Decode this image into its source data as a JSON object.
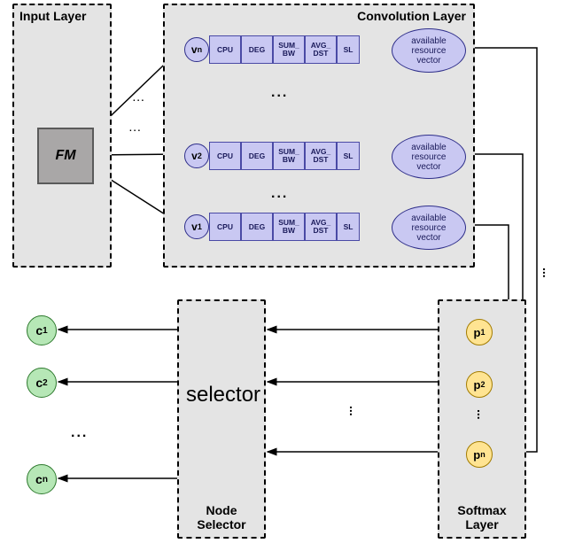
{
  "layers": {
    "input": {
      "title": "Input Layer",
      "fm": "FM"
    },
    "conv": {
      "title": "Convolution Layer",
      "rows": [
        {
          "label": "v",
          "sub": "n",
          "cells": [
            "CPU",
            "DEG",
            "SUM_\nBW",
            "AVG_\nDST",
            "SL"
          ],
          "vec": "available\nresource\nvector"
        },
        {
          "label": "v",
          "sub": "2",
          "cells": [
            "CPU",
            "DEG",
            "SUM_\nBW",
            "AVG_\nDST",
            "SL"
          ],
          "vec": "available\nresource\nvector"
        },
        {
          "label": "v",
          "sub": "1",
          "cells": [
            "CPU",
            "DEG",
            "SUM_\nBW",
            "AVG_\nDST",
            "SL"
          ],
          "vec": "available\nresource\nvector"
        }
      ],
      "hDots": "...",
      "between": "...",
      "fmRowGapDots": [
        "...",
        "..."
      ]
    },
    "softmax": {
      "title": "Softmax\nLayer",
      "nodes": [
        {
          "label": "p",
          "sub": "1"
        },
        {
          "label": "p",
          "sub": "2"
        },
        {
          "label": "p",
          "sub": "n"
        }
      ],
      "dots": "..."
    },
    "selector": {
      "title": "Node\nSelector",
      "big": "selector"
    },
    "outputs": {
      "nodes": [
        {
          "label": "c",
          "sub": "1"
        },
        {
          "label": "c",
          "sub": "2"
        },
        {
          "label": "c",
          "sub": "n"
        }
      ],
      "dots": "..."
    },
    "sideDots": "..."
  }
}
